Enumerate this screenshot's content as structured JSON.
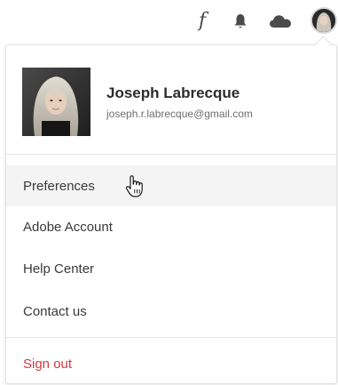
{
  "toolbar": {
    "fonts_glyph": "f",
    "icons": [
      "fonts-icon",
      "bell-icon",
      "cloud-icon",
      "avatar"
    ]
  },
  "profile": {
    "name": "Joseph Labrecque",
    "email": "joseph.r.labrecque@gmail.com"
  },
  "menu": {
    "items": [
      {
        "label": "Preferences",
        "state": "hover"
      },
      {
        "label": "Adobe Account"
      },
      {
        "label": "Help Center"
      },
      {
        "label": "Contact us"
      }
    ],
    "signout_label": "Sign out"
  },
  "colors": {
    "signout": "#d7373f",
    "text": "#3a3a3a",
    "hover_bg": "#f4f4f4",
    "icon": "#4b4b4b"
  }
}
